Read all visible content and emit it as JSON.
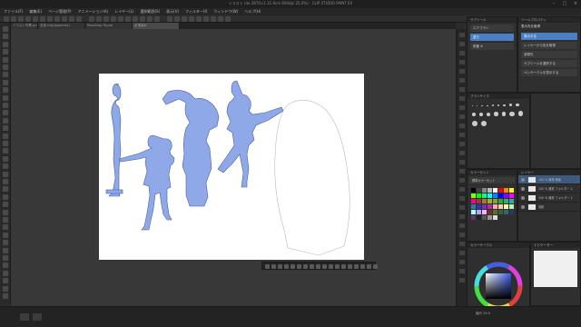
{
  "title": "イラスト (4e 2870×1 21.6cm 600dpi 25.0%) - CLIP STUDIO PAINT EX",
  "menu": [
    "ファイル(F)",
    "編集(E)",
    "ページ管理(P)",
    "アニメーション(A)",
    "レイヤー(L)",
    "選択範囲(S)",
    "表示(V)",
    "フィルター(I)",
    "ウィンドウ(W)",
    "ヘルプ(H)"
  ],
  "tabs": [
    "イラスト作業.png",
    "全身.clip(Japanese)",
    "PoseDrop Figure",
    "イラスト"
  ],
  "subtool_panel": {
    "header": "サブツール",
    "items": [
      "エアブラシ",
      "塗り",
      "鉛筆 ※"
    ]
  },
  "tool_property": {
    "header": "ツールプロパティ",
    "title": "表示先を取得",
    "items": [
      "表示する",
      "レイヤーから色を取得",
      "参照先",
      "サブツールを選択する",
      "ペンサークルを表示する"
    ]
  },
  "material_header": "ブラシサイズ",
  "color_panel": {
    "header": "カラーセット",
    "set_name": "標準カラーセット"
  },
  "layer_panel": {
    "header": "レイヤー",
    "layers": [
      "100 % 通常 線画",
      "100 % 通常 フォルダー 2",
      "100 % 通常 フォルダー 1",
      "用紙"
    ]
  },
  "color_wheel_header": "カラーサークル",
  "status": {
    "zoom": "25.0",
    "left": "",
    "right": "縮尺 25.0"
  },
  "navigator_header": "ナビゲーター",
  "colors": {
    "bg": "#2b2b2b",
    "accent": "#4a7fc1",
    "figure_fill": "#8ea8e8",
    "figure_stroke": "#4a5fa8"
  }
}
